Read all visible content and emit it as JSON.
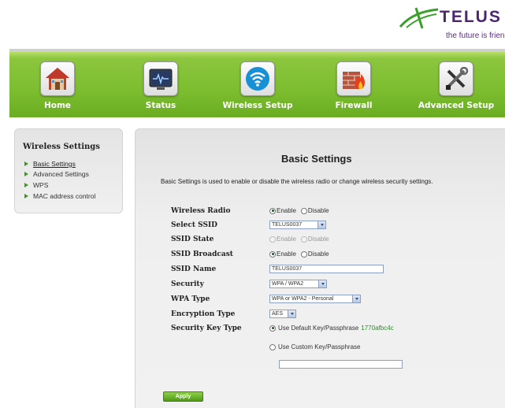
{
  "brand": {
    "name": "TELUS",
    "tagline": "the future is friendly",
    "color_purple": "#4b286d",
    "color_green": "#7cbd2f"
  },
  "nav": {
    "items": [
      {
        "label": "Home",
        "icon": "home-icon"
      },
      {
        "label": "Status",
        "icon": "status-monitor-icon"
      },
      {
        "label": "Wireless Setup",
        "icon": "wifi-icon"
      },
      {
        "label": "Firewall",
        "icon": "firewall-icon"
      },
      {
        "label": "Advanced Setup",
        "icon": "tools-icon"
      }
    ]
  },
  "sidebar": {
    "title": "Wireless Settings",
    "items": [
      {
        "label": "Basic Settings",
        "active": true
      },
      {
        "label": "Advanced Settings",
        "active": false
      },
      {
        "label": "WPS",
        "active": false
      },
      {
        "label": "MAC address control",
        "active": false
      }
    ]
  },
  "main": {
    "title": "Basic Settings",
    "description": "Basic Settings is used to enable or disable the wireless radio or change wireless security settings.",
    "fields": {
      "wireless_radio": {
        "label": "Wireless Radio",
        "options": [
          "Enable",
          "Disable"
        ],
        "selected": "Enable"
      },
      "select_ssid": {
        "label": "Select SSID",
        "value": "TELUS0037"
      },
      "ssid_state": {
        "label": "SSID State",
        "options": [
          "Enable",
          "Disable"
        ],
        "selected": "Enable",
        "disabled": true
      },
      "ssid_broadcast": {
        "label": "SSID Broadcast",
        "options": [
          "Enable",
          "Disable"
        ],
        "selected": "Enable"
      },
      "ssid_name": {
        "label": "SSID Name",
        "value": "TELUS0037"
      },
      "security": {
        "label": "Security",
        "value": "WPA / WPA2"
      },
      "wpa_type": {
        "label": "WPA Type",
        "value": "WPA or WPA2 - Personal"
      },
      "encryption_type": {
        "label": "Encryption Type",
        "value": "AES"
      },
      "security_key_type": {
        "label": "Security Key Type",
        "default_option": "Use Default Key/Passphrase",
        "default_key": "1770afbc4c",
        "custom_option": "Use Custom Key/Passphrase",
        "selected": "default",
        "custom_value": ""
      }
    },
    "apply_label": "Apply"
  }
}
